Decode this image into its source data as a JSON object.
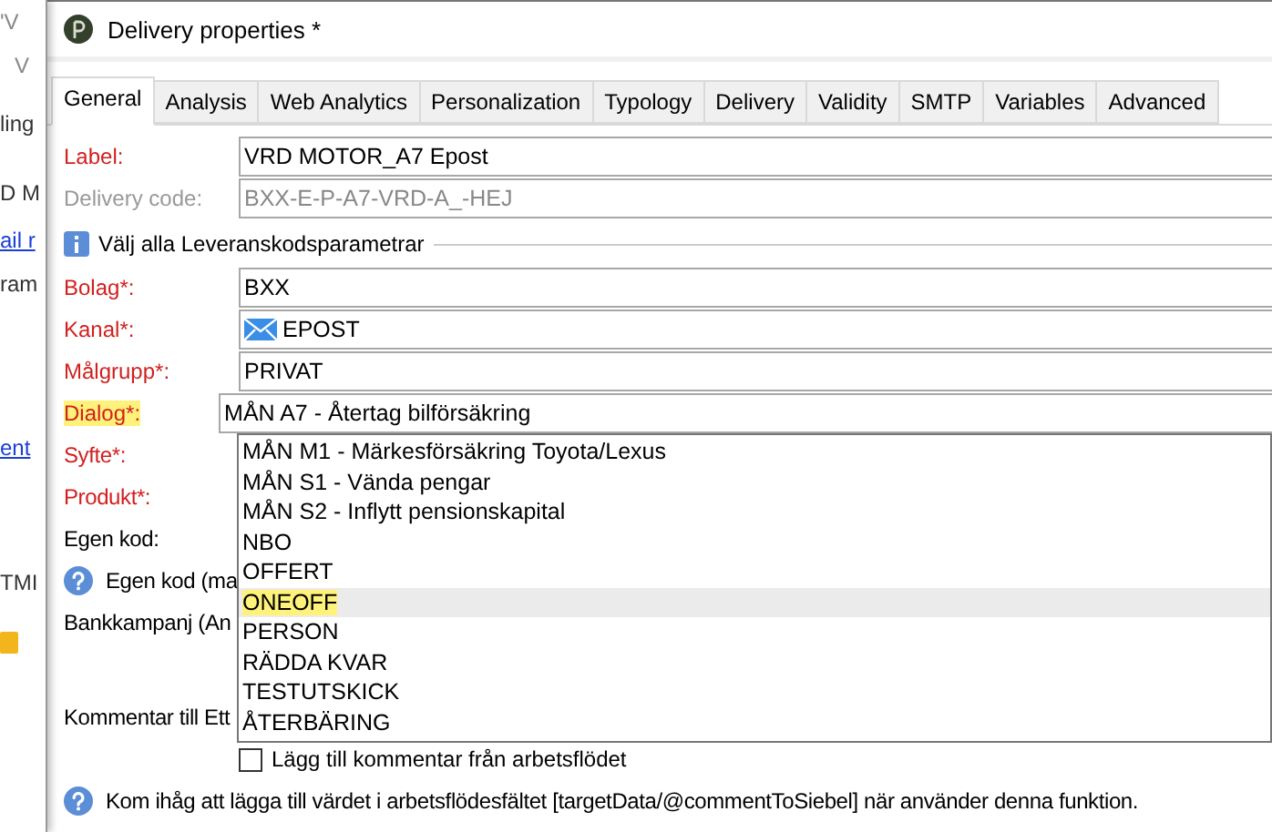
{
  "background_window": {
    "fragments": [
      {
        "text": "'V",
        "kind": "text"
      },
      {
        "text": "V",
        "kind": "text"
      },
      {
        "text": "ling",
        "kind": "text"
      },
      {
        "text": "D M",
        "kind": "text"
      },
      {
        "text": "ail r",
        "kind": "link"
      },
      {
        "text": "ram",
        "kind": "text"
      },
      {
        "text": "ent",
        "kind": "link"
      },
      {
        "text": "TMI",
        "kind": "text"
      }
    ]
  },
  "window": {
    "title": "Delivery properties *"
  },
  "tabs": [
    {
      "label": "General",
      "selected": true
    },
    {
      "label": "Analysis",
      "selected": false
    },
    {
      "label": "Web Analytics",
      "selected": false
    },
    {
      "label": "Personalization",
      "selected": false
    },
    {
      "label": "Typology",
      "selected": false
    },
    {
      "label": "Delivery",
      "selected": false
    },
    {
      "label": "Validity",
      "selected": false
    },
    {
      "label": "SMTP",
      "selected": false
    },
    {
      "label": "Variables",
      "selected": false
    },
    {
      "label": "Advanced",
      "selected": false
    }
  ],
  "form": {
    "rows": [
      {
        "kind": "field",
        "label": "Label:",
        "required": true,
        "disabled": false,
        "highlighted": false,
        "value": "VRD MOTOR_A7 Epost"
      },
      {
        "kind": "field",
        "label": "Delivery code:",
        "required": false,
        "disabled": true,
        "highlighted": false,
        "value": "BXX-E-P-A7-VRD-A_-HEJ"
      },
      {
        "kind": "section",
        "label": "Välj alla Leveranskodsparametrar"
      },
      {
        "kind": "field",
        "label": "Bolag*:",
        "required": true,
        "disabled": false,
        "highlighted": false,
        "value": "BXX"
      },
      {
        "kind": "mail-field",
        "label": "Kanal*:",
        "required": true,
        "disabled": false,
        "highlighted": false,
        "value": "EPOST"
      },
      {
        "kind": "field",
        "label": "Målgrupp*:",
        "required": true,
        "disabled": false,
        "highlighted": false,
        "value": "PRIVAT"
      },
      {
        "kind": "dropdown",
        "label": "Dialog*:",
        "required": true,
        "disabled": false,
        "highlighted": true,
        "value": "MÅN A7 - Återtag bilförsäkring",
        "options": [
          {
            "text": "MÅN M1 - Märkesförsäkring Toyota/Lexus",
            "selected": false,
            "highlighted": false
          },
          {
            "text": "MÅN S1 - Vända pengar",
            "selected": false,
            "highlighted": false
          },
          {
            "text": "MÅN S2 - Inflytt pensionskapital",
            "selected": false,
            "highlighted": false
          },
          {
            "text": "NBO",
            "selected": false,
            "highlighted": false
          },
          {
            "text": "OFFERT",
            "selected": false,
            "highlighted": false
          },
          {
            "text": "ONEOFF",
            "selected": true,
            "highlighted": true
          },
          {
            "text": "PERSON",
            "selected": false,
            "highlighted": false
          },
          {
            "text": "RÄDDA KVAR",
            "selected": false,
            "highlighted": false
          },
          {
            "text": "TESTUTSKICK",
            "selected": false,
            "highlighted": false
          },
          {
            "text": "ÅTERBÄRING",
            "selected": false,
            "highlighted": false
          }
        ]
      },
      {
        "kind": "label",
        "label": "Syfte*:",
        "required": true
      },
      {
        "kind": "label",
        "label": "Produkt*:",
        "required": true
      },
      {
        "kind": "label",
        "label": "Egen kod:",
        "required": false
      },
      {
        "kind": "help",
        "label": "Egen kod (ma"
      },
      {
        "kind": "label",
        "label": "Bankkampanj (An",
        "required": false
      },
      {
        "kind": "spacer"
      },
      {
        "kind": "label",
        "label": "Kommentar till Ett",
        "required": false
      },
      {
        "kind": "checkbox",
        "label": "Lägg till kommentar från arbetsflödet",
        "checked": false
      },
      {
        "kind": "help",
        "label": "Kom ihåg att lägga till värdet i arbetsflödesfältet [targetData/@commentToSiebel] när använder denna funktion."
      }
    ]
  }
}
